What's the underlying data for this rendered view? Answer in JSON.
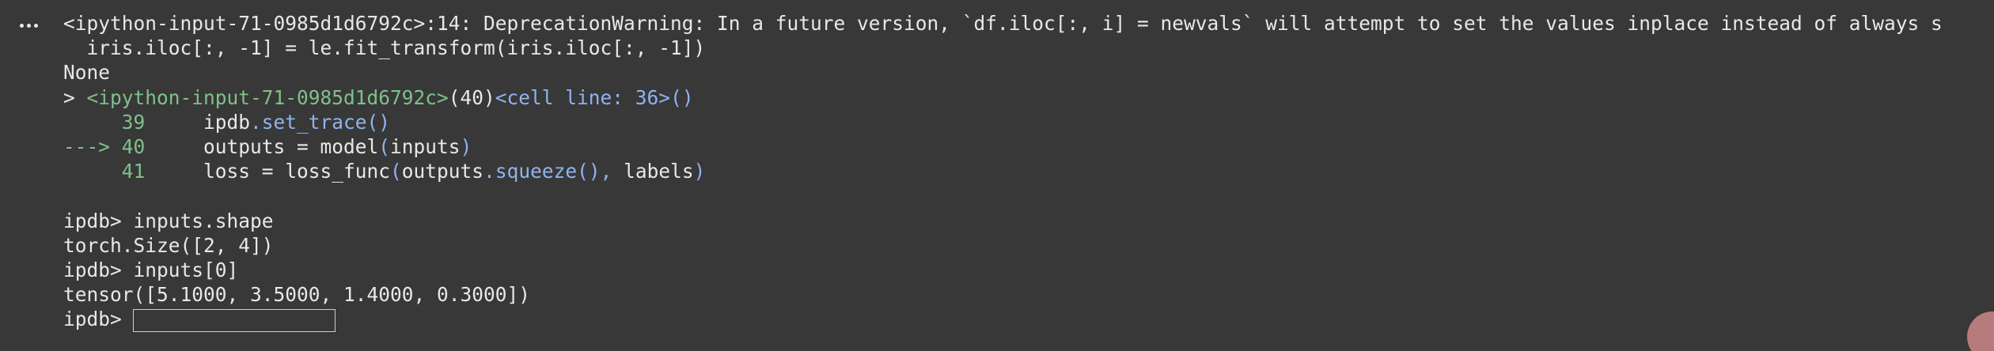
{
  "output_menu_icon": "more-horiz-icon",
  "warning": {
    "part1": "<ipython-input-71-0985d1d6792c>:14: DeprecationWarning: In a future version, `df.iloc[:, i] = newvals` will attempt to set the values inplace instead of always s",
    "part2": "  iris.iloc[:, -1] = le.fit_transform(iris.iloc[:, -1])"
  },
  "none_line": "None",
  "location": {
    "prefix": "> ",
    "file": "<ipython-input-71-0985d1d6792c>",
    "lineno": "(40)",
    "cell": "<cell line: 36>",
    "parens": "()"
  },
  "code_lines": [
    {
      "marker": "     39",
      "a": "     ipdb",
      "b": ".set_trace()",
      "c": "",
      "d": "",
      "e": "",
      "f": ""
    },
    {
      "marker": "---> 40",
      "a": "     outputs = model",
      "b": "(",
      "c": "inputs",
      "d": ")",
      "e": "",
      "f": ""
    },
    {
      "marker": "     41",
      "a": "     loss = loss_func",
      "b": "(",
      "c": "outputs",
      "d": ".squeeze(),",
      "e": " labels",
      "f": ")"
    }
  ],
  "history": [
    "ipdb> inputs.shape",
    "torch.Size([2, 4])",
    "ipdb> inputs[0]",
    "tensor([5.1000, 3.5000, 1.4000, 0.3000])"
  ],
  "prompt": "ipdb>",
  "stdin_value": ""
}
